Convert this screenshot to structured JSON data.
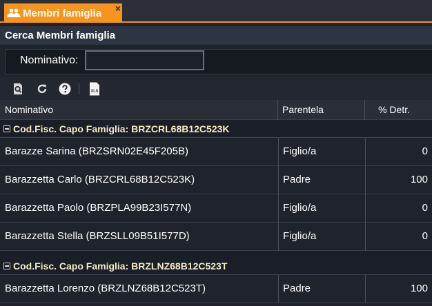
{
  "tab": {
    "label": "Membri famiglia",
    "icon": "people-icon",
    "close": "×"
  },
  "search": {
    "title": "Cerca Membri famiglia",
    "field_label": "Nominativo:",
    "field_value": ""
  },
  "toolbar": {
    "items": [
      "search-preview-icon",
      "refresh-icon",
      "help-icon",
      "export-xls-icon"
    ],
    "xls_text": "XLS"
  },
  "grid": {
    "columns": [
      "Nominativo",
      "Parentela",
      "% Detr."
    ],
    "groups": [
      {
        "label": "Cod.Fisc. Capo Famiglia: BRZCRL68B12C523K",
        "rows": [
          {
            "nominativo": "Barazze Sarina (BRZSRN02E45F205B)",
            "parentela": "Figlio/a",
            "detr": "0"
          },
          {
            "nominativo": "Barazzetta Carlo (BRZCRL68B12C523K)",
            "parentela": "Padre",
            "detr": "100"
          },
          {
            "nominativo": "Barazzetta Paolo (BRZPLA99B23I577N)",
            "parentela": "Figlio/a",
            "detr": "0"
          },
          {
            "nominativo": "Barazzetta Stella (BRZSLL09B51I577D)",
            "parentela": "Figlio/a",
            "detr": "0"
          }
        ]
      },
      {
        "label": "Cod.Fisc. Capo Famiglia: BRZLNZ68B12C523T",
        "rows": [
          {
            "nominativo": "Barazzetta Lorenzo (BRZLNZ68B12C523T)",
            "parentela": "Padre",
            "detr": "100"
          }
        ]
      }
    ]
  },
  "colors": {
    "accent": "#f7941d",
    "group_text": "#f4ecc6",
    "background": "#1f232b"
  }
}
